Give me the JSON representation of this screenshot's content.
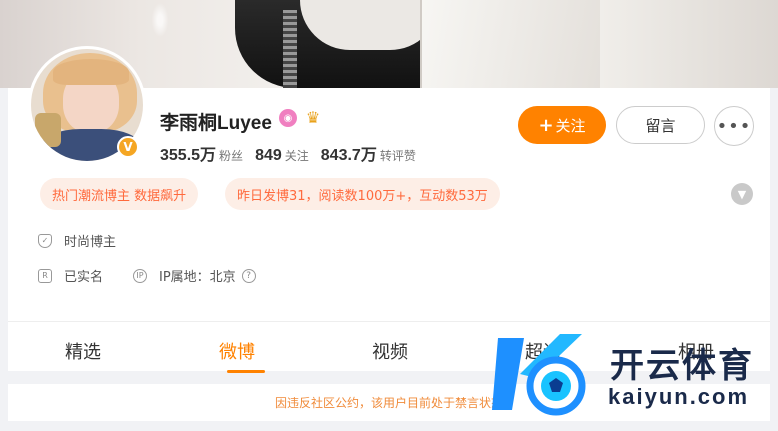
{
  "profile": {
    "name": "李雨桐Luyee",
    "verified_badge": "V",
    "badges": [
      "pink-circle-icon",
      "crown-icon"
    ],
    "stats": [
      {
        "value": "355.5万",
        "label": "粉丝"
      },
      {
        "value": "849",
        "label": "关注"
      },
      {
        "value": "843.7万",
        "label": "转评赞"
      }
    ]
  },
  "actions": {
    "follow_plus": "+",
    "follow_label": "关注",
    "message_label": "留言",
    "more_label": "•••"
  },
  "tags": {
    "tag1": "热门潮流博主 数据飙升",
    "tag2": "昨日发博31，阅读数100万+，互动数53万"
  },
  "info": {
    "category": "时尚博主",
    "realname": "已实名",
    "ip_label": "IP属地：北京",
    "help": "?"
  },
  "tabs": [
    "精选",
    "微博",
    "视频",
    "超话",
    "相册"
  ],
  "active_tab": "微博",
  "notice": "因违反社区公约，该用户目前处于禁言状态",
  "watermark": {
    "brand": "开云体育",
    "url": "kaiyun.com"
  },
  "colors": {
    "accent": "#ff8200",
    "tag_bg": "#fdeee6",
    "tag_text": "#ff6a3d"
  }
}
